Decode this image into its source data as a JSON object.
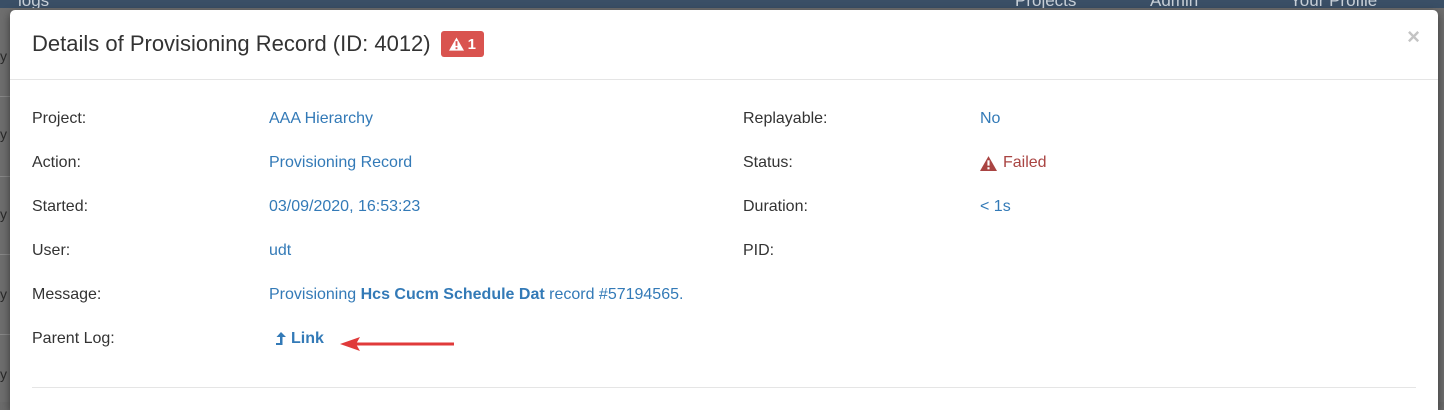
{
  "background": {
    "nav_items": [
      "logs",
      "Projects",
      "Admin",
      "Your Profile"
    ],
    "side_letters": [
      "y",
      "y",
      "y",
      "y",
      "y"
    ]
  },
  "modal": {
    "title": "Details of Provisioning Record (ID: 4012)",
    "badge_count": "1",
    "close_label": "×",
    "left_fields": [
      {
        "label": "Project:",
        "value": "AAA Hierarchy"
      },
      {
        "label": "Action:",
        "value": "Provisioning Record"
      },
      {
        "label": "Started:",
        "value": "03/09/2020, 16:53:23"
      },
      {
        "label": "User:",
        "value": "udt"
      }
    ],
    "right_fields": [
      {
        "label": "Replayable:",
        "value": "No"
      },
      {
        "label": "Status:",
        "value": "Failed"
      },
      {
        "label": "Duration:",
        "value": "< 1s"
      },
      {
        "label": "PID:",
        "value": ""
      }
    ],
    "message": {
      "label": "Message:",
      "prefix": "Provisioning ",
      "bold": "Hcs Cucm Schedule Dat",
      "suffix": " record #57194565."
    },
    "parent_log": {
      "label": "Parent Log:",
      "link_label": "Link"
    }
  },
  "colors": {
    "link_blue": "#337ab7",
    "danger_red": "#d9534f",
    "failed_text": "#a94442",
    "annotation_arrow": "#e03a3a"
  },
  "icons": {
    "badge": "warning-triangle-icon",
    "status": "warning-triangle-icon",
    "parent_log": "level-up-icon",
    "annotation": "red-arrow-annotation"
  }
}
